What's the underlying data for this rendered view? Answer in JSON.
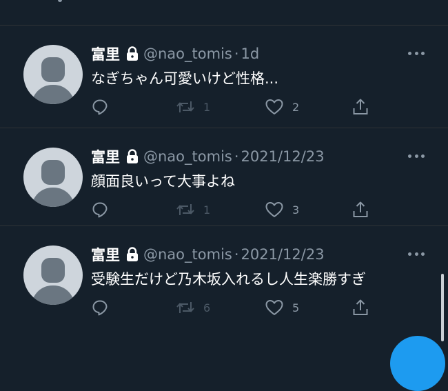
{
  "colors": {
    "background": "#15202b",
    "primary_text": "#ffffff",
    "secondary_text": "#8b98a5",
    "divider": "#2f3336",
    "accent": "#1d9bf0"
  },
  "tweets": [
    {
      "display_name": "富里",
      "handle": "@nao_tomis",
      "separator": "·",
      "time": "1d",
      "text": "なぎちゃん可愛いけど性格...",
      "reply_count": "",
      "retweet_count": "1",
      "like_count": "2",
      "icons": {
        "avatar": "default-avatar",
        "lock": "lock-icon",
        "more": "more-icon",
        "reply": "reply-icon",
        "retweet": "retweet-icon",
        "like": "heart-icon",
        "share": "share-icon"
      }
    },
    {
      "display_name": "富里",
      "handle": "@nao_tomis",
      "separator": "·",
      "time": "2021/12/23",
      "text": "顔面良いって大事よね",
      "reply_count": "",
      "retweet_count": "1",
      "like_count": "3",
      "icons": {
        "avatar": "default-avatar",
        "lock": "lock-icon",
        "more": "more-icon",
        "reply": "reply-icon",
        "retweet": "retweet-icon",
        "like": "heart-icon",
        "share": "share-icon"
      }
    },
    {
      "display_name": "富里",
      "handle": "@nao_tomis",
      "separator": "·",
      "time": "2021/12/23",
      "text": "受験生だけど乃木坂入れるし人生楽勝すぎ",
      "reply_count": "",
      "retweet_count": "6",
      "like_count": "5",
      "icons": {
        "avatar": "default-avatar",
        "lock": "lock-icon",
        "more": "more-icon",
        "reply": "reply-icon",
        "retweet": "retweet-icon",
        "like": "heart-icon",
        "share": "share-icon"
      }
    }
  ]
}
